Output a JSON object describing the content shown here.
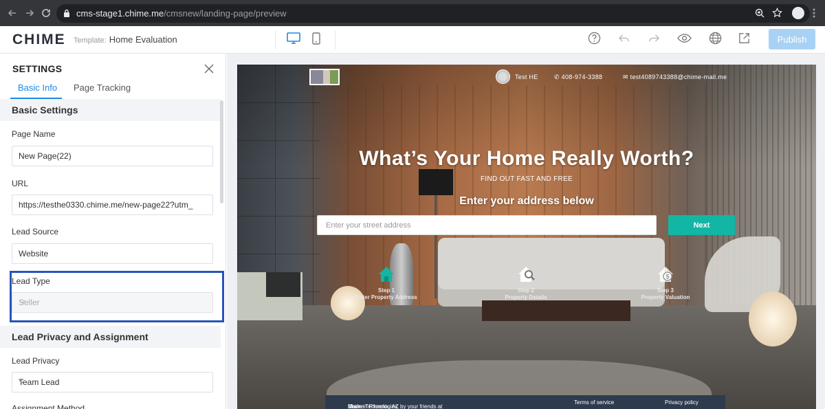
{
  "browser": {
    "url_host": "cms-stage1.chime.me",
    "url_path": "/cmsnew/landing-page/preview"
  },
  "app": {
    "logo": "CHIME",
    "template_label": "Template:",
    "template_name": "Home Evaluation",
    "publish_label": "Publish",
    "accent_color": "#1e88e5"
  },
  "settings": {
    "title": "SETTINGS",
    "tabs": [
      {
        "label": "Basic Info",
        "active": true
      },
      {
        "label": "Page Tracking",
        "active": false
      }
    ],
    "basic_settings_title": "Basic Settings",
    "page_name_label": "Page Name",
    "page_name_value": "New Page(22)",
    "url_label": "URL",
    "url_value": "https://testhe0330.chime.me/new-page22?utm_",
    "lead_source_label": "Lead Source",
    "lead_source_value": "Website",
    "lead_type_label": "Lead Type",
    "lead_type_value": "Seller",
    "privacy_section_title": "Lead Privacy and Assignment",
    "lead_privacy_label": "Lead Privacy",
    "lead_privacy_value": "Team Lead",
    "assignment_method_label": "Assignment Method"
  },
  "preview": {
    "agent_name": "Test HE",
    "phone": "408-974-3388",
    "email": "test4089743388@chime-mail.me",
    "hero_title": "What’s Your Home Really Worth?",
    "hero_subtitle": "FIND OUT FAST AND FREE",
    "hero_cta": "Enter your address below",
    "address_placeholder": "Enter your street address",
    "next_label": "Next",
    "next_color": "#12b6a4",
    "steps": [
      {
        "num": "Step 1",
        "label": "Enter Property Address",
        "icon": "house-icon"
      },
      {
        "num": "Step 2",
        "label": "Property Details",
        "icon": "house-search-icon"
      },
      {
        "num": "Step 3",
        "label": "Property Valuation",
        "icon": "house-dollar-icon"
      }
    ],
    "footer": {
      "made_in": "Made in Phoenix, AZ by your friends at",
      "company": "Chime Technologies,",
      "inc": "Inc.",
      "terms": "Terms of service",
      "privacy": "Privacy policy"
    }
  }
}
